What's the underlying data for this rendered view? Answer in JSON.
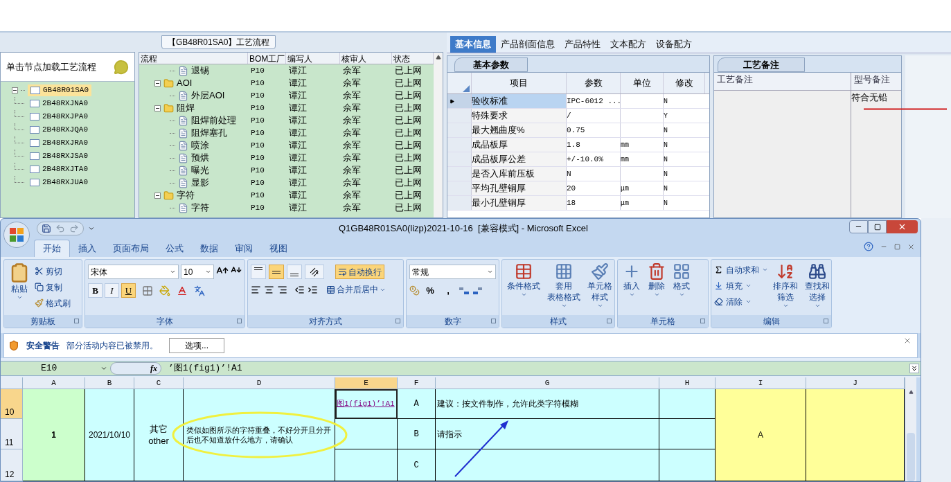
{
  "process_window": {
    "title": "【GB48R01SA0】工艺流程",
    "hint": "单击节点加载工艺流程",
    "tree": {
      "label": "GB48R01SA0",
      "selected": true,
      "expanded": true,
      "children": [
        {
          "label": "2B48RXJNA0",
          "selected": false
        },
        {
          "label": "2B48RXJPA0",
          "selected": false
        },
        {
          "label": "2B48RXJQA0",
          "selected": false
        },
        {
          "label": "2B48RXJRA0",
          "selected": false
        },
        {
          "label": "2B48RXJSA0",
          "selected": false
        },
        {
          "label": "2B48RXJTA0",
          "selected": false
        },
        {
          "label": "2B48RXJUA0",
          "selected": false
        }
      ]
    },
    "flow_table": {
      "columns": [
        "流程",
        "BOM工厂",
        "编写人",
        "核审人",
        "状态"
      ],
      "rows": [
        {
          "kind": "step",
          "name": "退锡",
          "bom": "P10",
          "author": "谭江",
          "reviewer": "佘军",
          "status": "已上网"
        },
        {
          "kind": "group",
          "name": "AOI",
          "expanded": true,
          "bom": "P10",
          "author": "谭江",
          "reviewer": "佘军",
          "status": "已上网",
          "children": [
            {
              "kind": "step",
              "name": "外层AOI",
              "bom": "P10",
              "author": "谭江",
              "reviewer": "佘军",
              "status": "已上网"
            }
          ]
        },
        {
          "kind": "group",
          "name": "阻焊",
          "expanded": true,
          "bom": "P10",
          "author": "谭江",
          "reviewer": "佘军",
          "status": "已上网",
          "children": [
            {
              "kind": "step",
              "name": "阻焊前处理",
              "bom": "P10",
              "author": "谭江",
              "reviewer": "佘军",
              "status": "已上网"
            },
            {
              "kind": "step",
              "name": "阻焊塞孔",
              "bom": "P10",
              "author": "谭江",
              "reviewer": "佘军",
              "status": "已上网"
            },
            {
              "kind": "step",
              "name": "喷涂",
              "bom": "P10",
              "author": "谭江",
              "reviewer": "佘军",
              "status": "已上网"
            },
            {
              "kind": "step",
              "name": "预烘",
              "bom": "P10",
              "author": "谭江",
              "reviewer": "佘军",
              "status": "已上网"
            },
            {
              "kind": "step",
              "name": "曝光",
              "bom": "P10",
              "author": "谭江",
              "reviewer": "佘军",
              "status": "已上网"
            },
            {
              "kind": "step",
              "name": "显影",
              "bom": "P10",
              "author": "谭江",
              "reviewer": "佘军",
              "status": "已上网"
            }
          ]
        },
        {
          "kind": "group",
          "name": "字符",
          "expanded": true,
          "bom": "P10",
          "author": "谭江",
          "reviewer": "佘军",
          "status": "已上网",
          "children": [
            {
              "kind": "step",
              "name": "字符",
              "bom": "P10",
              "author": "谭江",
              "reviewer": "佘军",
              "status": "已上网"
            }
          ]
        }
      ]
    }
  },
  "info_panel": {
    "tabs": [
      {
        "label": "基本信息",
        "selected": true
      },
      {
        "label": "产品剖面信息",
        "selected": false
      },
      {
        "label": "产品特性",
        "selected": false
      },
      {
        "label": "文本配方",
        "selected": false
      },
      {
        "label": "设备配方",
        "selected": false
      }
    ],
    "params": {
      "tab": "基本参数",
      "columns": [
        "项目",
        "参数",
        "单位",
        "修改"
      ],
      "rows": [
        {
          "item": "验收标准",
          "value": "IPC-6012 ...",
          "modified": "N",
          "selected": true
        },
        {
          "item": "特殊要求",
          "value": "/",
          "modified": "Y",
          "selected": false
        },
        {
          "item": "最大翘曲度%",
          "value": "0.75",
          "modified": "N",
          "selected": false
        },
        {
          "item": "成品板厚",
          "value": "1.8",
          "unit": "mm",
          "modified": "N",
          "selected": false
        },
        {
          "item": "成品板厚公差",
          "value": "+/-10.0%",
          "unit": "mm",
          "modified": "N",
          "selected": false
        },
        {
          "item": "是否入库前压板",
          "value": "N",
          "modified": "N",
          "selected": false
        },
        {
          "item": "平均孔壁铜厚",
          "value": "20",
          "unit": "μm",
          "modified": "N",
          "selected": false
        },
        {
          "item": "最小孔壁铜厚",
          "value": "18",
          "unit": "μm",
          "modified": "N",
          "selected": false
        }
      ]
    },
    "notes": {
      "tab": "工艺备注",
      "columns": [
        "工艺备注",
        "型号备注"
      ],
      "model_note": "符合无铅"
    }
  },
  "excel": {
    "title": "Q1GB48R01SA0(lizp)2021-10-16  [兼容模式] - Microsoft Excel",
    "tabs": [
      {
        "label": "开始",
        "selected": true
      },
      {
        "label": "插入",
        "selected": false
      },
      {
        "label": "页面布局",
        "selected": false
      },
      {
        "label": "公式",
        "selected": false
      },
      {
        "label": "数据",
        "selected": false
      },
      {
        "label": "审阅",
        "selected": false
      },
      {
        "label": "视图",
        "selected": false
      }
    ],
    "clipboard": {
      "title": "剪贴板",
      "paste": "粘贴",
      "items": [
        "剪切",
        "复制",
        "格式刷"
      ]
    },
    "font": {
      "title": "字体",
      "name": "宋体",
      "size": "10",
      "styles": [
        {
          "label": "B",
          "on": false
        },
        {
          "label": "I",
          "on": false
        },
        {
          "label": "U",
          "on": true
        }
      ]
    },
    "alignment": {
      "title": "对齐方式",
      "vertical": [
        {
          "on": false
        },
        {
          "on": true
        },
        {
          "on": false
        }
      ],
      "wrap": {
        "label": "自动换行",
        "on": true
      },
      "merge": "合并后居中"
    },
    "number": {
      "title": "数字",
      "format": "常规",
      "symbols": [
        "%",
        ","
      ]
    },
    "styles": {
      "title": "样式",
      "buttons": [
        [
          "条件格式"
        ],
        [
          "套用",
          "表格格式"
        ],
        [
          "单元格",
          "样式"
        ]
      ]
    },
    "cells": {
      "title": "单元格",
      "buttons": [
        "插入",
        "删除",
        "格式"
      ]
    },
    "editing": {
      "title": "编辑",
      "items": [
        "自动求和",
        "填充",
        "清除"
      ],
      "buttons": [
        [
          "排序和",
          "筛选"
        ],
        [
          "查找和",
          "选择"
        ]
      ]
    },
    "security": {
      "title": "安全警告",
      "message": "部分活动内容已被禁用。",
      "button": "选项..."
    },
    "formula_bar": {
      "name_box": "E10",
      "fx": "fx",
      "formula": "’图1(fig1)’!A1"
    },
    "sheet": {
      "rows": [
        {
          "label": "10",
          "selected": true
        },
        {
          "label": "11",
          "selected": false
        },
        {
          "label": "12",
          "selected": false
        }
      ],
      "columns": [
        {
          "label": "A",
          "selected": false,
          "merged": true,
          "text": "1",
          "bold": true
        },
        {
          "label": "B",
          "selected": false,
          "merged": true,
          "text": "2021/10/10"
        },
        {
          "label": "C",
          "selected": false,
          "merged": true,
          "text": "其它\nother"
        },
        {
          "label": "D",
          "selected": false,
          "merged": true,
          "text": "类似如图所示的字符重叠，不好分开且分开后也不知道放什么地方，请确认"
        },
        {
          "label": "E",
          "selected": true,
          "merged": false,
          "cells": [
            "图1(fig1)’!A1"
          ],
          "link": true
        },
        {
          "label": "F",
          "selected": false,
          "merged": false,
          "cells": [
            "A",
            "B",
            "C"
          ]
        },
        {
          "label": "G",
          "selected": false,
          "merged": false,
          "cells": [
            "建议：按文件制作，允许此类字符模糊",
            "请指示"
          ]
        },
        {
          "label": "H",
          "selected": false,
          "merged": false
        },
        {
          "label": "I",
          "selected": false,
          "merged": true,
          "text": "A"
        },
        {
          "label": "J",
          "selected": false,
          "merged": true
        }
      ]
    }
  }
}
